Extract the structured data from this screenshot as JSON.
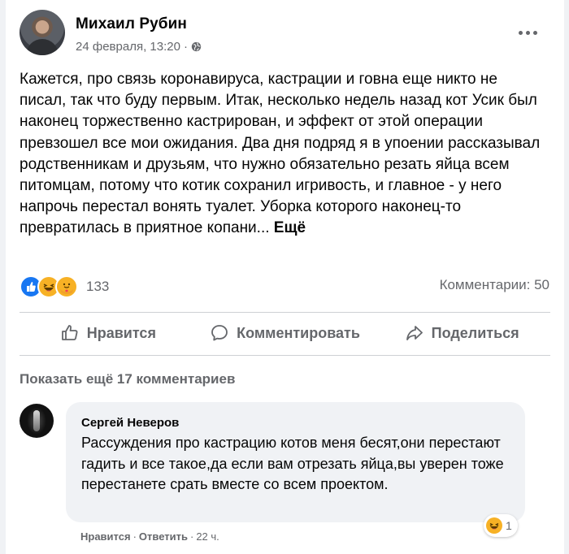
{
  "post": {
    "author": "Михаил Рубин",
    "date": "24 февраля, 13:20",
    "date_sep": "·",
    "text": "Кажется, про связь коронавируса, кастрации и говна еще никто не писал, так что буду первым. Итак, несколько недель назад кот Усик был наконец торжественно кастрирован, и эффект от этой операции превзошел все мои ожидания. Два дня подряд я в упоении рассказывал родственникам и друзьям, что нужно обязательно резать яйца всем питомцам, потому что котик сохранил игривость, и главное - у него напрочь перестал вонять туалет. Уборка которого наконец-то превратилась в приятное копани...",
    "more_label": "Ещё",
    "reactions": [
      "like",
      "haha",
      "care"
    ],
    "reaction_count": "133",
    "comments_count": "Комментарии: 50"
  },
  "actions": {
    "like": "Нравится",
    "comment": "Комментировать",
    "share": "Поделиться"
  },
  "show_more_comments": "Показать ещё 17 комментариев",
  "comment": {
    "author": "Сергей Неверов",
    "text": "Рассуждения про кастрацию котов меня бесят,они перестают гадить и все такое,да если вам отрезать яйца,вы уверен тоже перестанете срать вместе со всем проектом.",
    "reaction": "haha",
    "reaction_count": "1",
    "like_label": "Нравится",
    "reply_label": "Ответить",
    "time": "22 ч.",
    "sep": "·"
  },
  "colors": {
    "accent": "#1877f2",
    "secondary_text": "#65676b",
    "bubble": "#f0f2f5",
    "emoji": "#f7b125"
  }
}
